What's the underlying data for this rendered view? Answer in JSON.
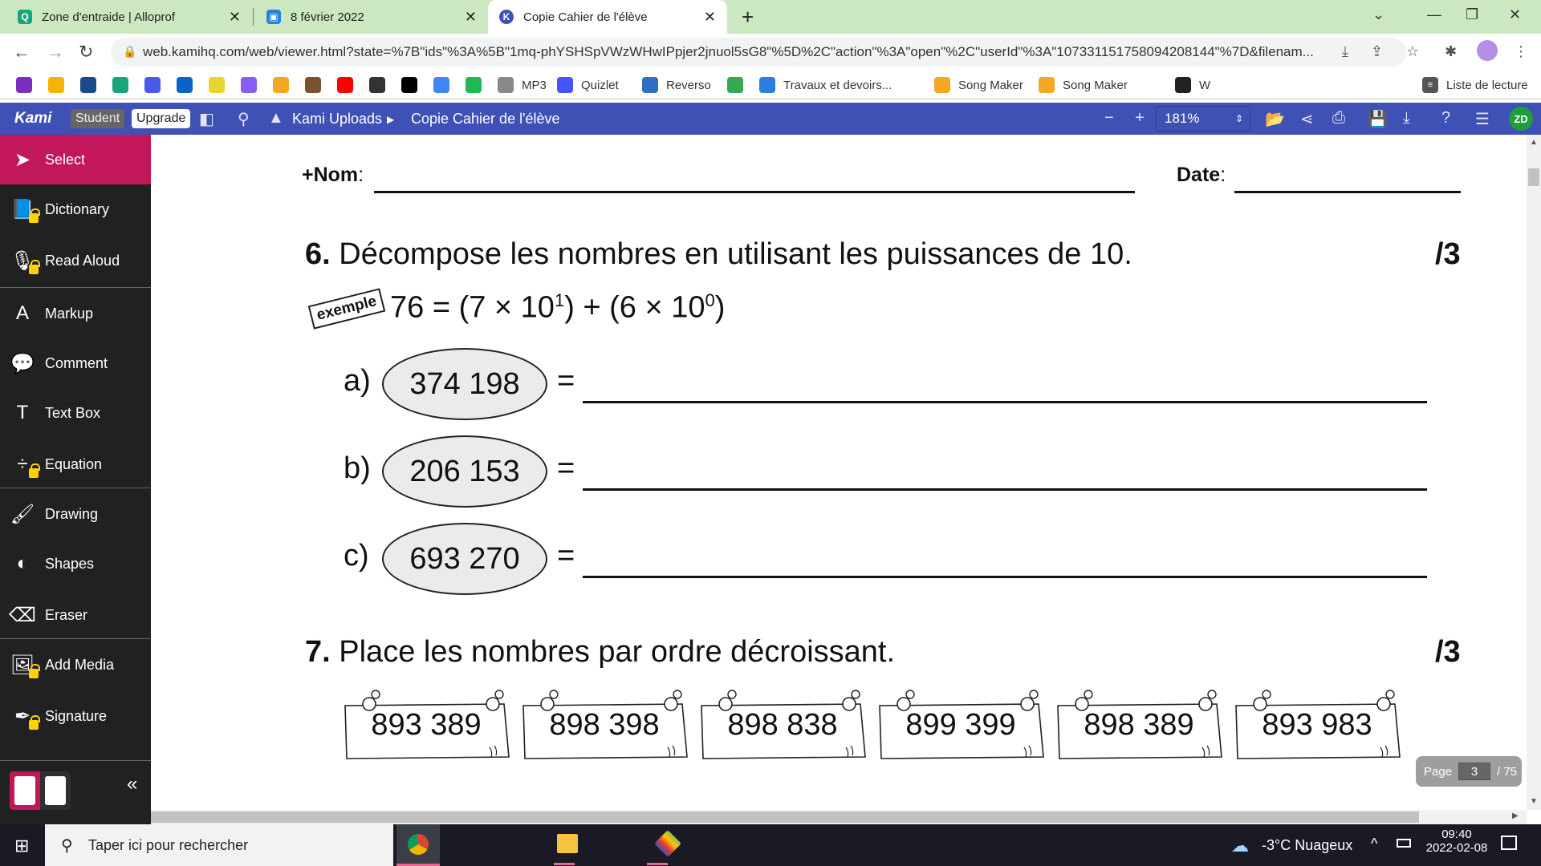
{
  "browser": {
    "tabs": [
      {
        "title": "Zone d'entraide | Alloprof",
        "icon": "alloprof-icon",
        "active": false
      },
      {
        "title": "8 février 2022",
        "icon": "classroom-icon",
        "active": false
      },
      {
        "title": "Copie Cahier de l'élève",
        "icon": "kami-icon",
        "active": true
      }
    ],
    "new_tab_label": "+",
    "url": "web.kamihq.com/web/viewer.html?state=%7B\"ids\"%3A%5B\"1mq-phYSHSpVWzWHwIPpjer2jnuol5sG8\"%5D%2C\"action\"%3A\"open\"%2C\"userId\"%3A\"107331151758094208144\"%7D&filenam...",
    "bookmarks": [
      {
        "label": "",
        "icon": "nm-icon",
        "color": "#7b2fbe"
      },
      {
        "label": "",
        "icon": "classroom-icon",
        "color": "#f4b400"
      },
      {
        "label": "",
        "icon": "badge-icon",
        "color": "#1a4a8a"
      },
      {
        "label": "",
        "icon": "alloprof-icon",
        "color": "#18a57a"
      },
      {
        "label": "",
        "icon": "canva-icon",
        "color": "#4a5ae8"
      },
      {
        "label": "",
        "icon": "outlook-icon",
        "color": "#0a64c8"
      },
      {
        "label": "",
        "icon": "pattern-icon",
        "color": "#e8d630"
      },
      {
        "label": "",
        "icon": "game-icon",
        "color": "#8a5cf6"
      },
      {
        "label": "",
        "icon": "songmaker-icon",
        "color": "#f5a623"
      },
      {
        "label": "",
        "icon": "bear-icon",
        "color": "#7a5230"
      },
      {
        "label": "",
        "icon": "youtube-icon",
        "color": "#ff0000"
      },
      {
        "label": "",
        "icon": "grid-icon",
        "color": "#333333"
      },
      {
        "label": "",
        "icon": "art-icon",
        "color": "#000000"
      },
      {
        "label": "",
        "icon": "google-icon",
        "color": "#4285f4"
      },
      {
        "label": "",
        "icon": "spotify-icon",
        "color": "#1db954"
      },
      {
        "label": "MP3",
        "icon": "play-icon",
        "color": "#888888"
      },
      {
        "label": "Quizlet",
        "icon": "quizlet-icon",
        "color": "#4255ff"
      },
      {
        "label": "Reverso",
        "icon": "reverso-icon",
        "color": "#2d6fc4"
      },
      {
        "label": "",
        "icon": "maps-icon",
        "color": "#34a853"
      },
      {
        "label": "Travaux et devoirs...",
        "icon": "classroom-icon",
        "color": "#2a7de1"
      },
      {
        "label": "Song Maker",
        "icon": "songmaker-icon",
        "color": "#f5a623"
      },
      {
        "label": "Song Maker",
        "icon": "songmaker-icon",
        "color": "#f5a623"
      },
      {
        "label": "",
        "icon": "wordreference-icon",
        "color": "#ffffff"
      },
      {
        "label": "W",
        "icon": "globe-icon",
        "color": "#222222"
      }
    ],
    "reading_list": "Liste de lecture"
  },
  "kami": {
    "logo": "Kami",
    "student_badge": "Student",
    "upgrade_button": "Upgrade",
    "breadcrumb_root": "Kami Uploads",
    "breadcrumb_file": "Copie Cahier de l'élève",
    "zoom_level": "181%",
    "avatar_initials": "ZD",
    "accent_color": "#3f51b5",
    "select_color": "#c2185b"
  },
  "sidebar": {
    "items": [
      {
        "label": "Select",
        "icon": "cursor-arrow-icon",
        "locked": false,
        "active": true
      },
      {
        "label": "Dictionary",
        "icon": "book-icon",
        "locked": true
      },
      {
        "label": "Read Aloud",
        "icon": "microphone-icon",
        "locked": true
      },
      {
        "label": "Markup",
        "icon": "markup-icon",
        "locked": false
      },
      {
        "label": "Comment",
        "icon": "comment-icon",
        "locked": false
      },
      {
        "label": "Text Box",
        "icon": "text-icon",
        "locked": false
      },
      {
        "label": "Equation",
        "icon": "divide-icon",
        "locked": true
      },
      {
        "label": "Drawing",
        "icon": "brush-icon",
        "locked": false
      },
      {
        "label": "Shapes",
        "icon": "shapes-icon",
        "locked": false
      },
      {
        "label": "Eraser",
        "icon": "eraser-icon",
        "locked": false
      },
      {
        "label": "Add Media",
        "icon": "image-icon",
        "locked": true
      },
      {
        "label": "Signature",
        "icon": "pen-nib-icon",
        "locked": true
      }
    ],
    "collapse_label": "«"
  },
  "document": {
    "name_label": "+Nom",
    "date_label": "Date",
    "colon": ":",
    "q6": {
      "number": "6.",
      "title": "Décompose les nombres en utilisant les puissances de 10.",
      "score": "/3",
      "example_tag": "exemple",
      "example_main": "76 = (7 × 10",
      "example_exp1": "1",
      "example_mid": ") + (6 × 10",
      "example_exp2": "0",
      "example_end": ")",
      "items": [
        {
          "letter": "a)",
          "number": "374 198",
          "equals": "="
        },
        {
          "letter": "b)",
          "number": "206 153",
          "equals": "="
        },
        {
          "letter": "c)",
          "number": "693 270",
          "equals": "="
        }
      ]
    },
    "q7": {
      "number": "7.",
      "title": "Place les nombres par ordre décroissant.",
      "score": "/3",
      "notes": [
        "893 389",
        "898 398",
        "898 838",
        "899 399",
        "898 389",
        "893 983"
      ]
    }
  },
  "pager": {
    "label": "Page",
    "current": "3",
    "total": "/ 75"
  },
  "taskbar": {
    "search_placeholder": "Taper ici pour rechercher",
    "weather": "-3°C  Nuageux",
    "time": "09:40",
    "date": "2022-02-08"
  }
}
